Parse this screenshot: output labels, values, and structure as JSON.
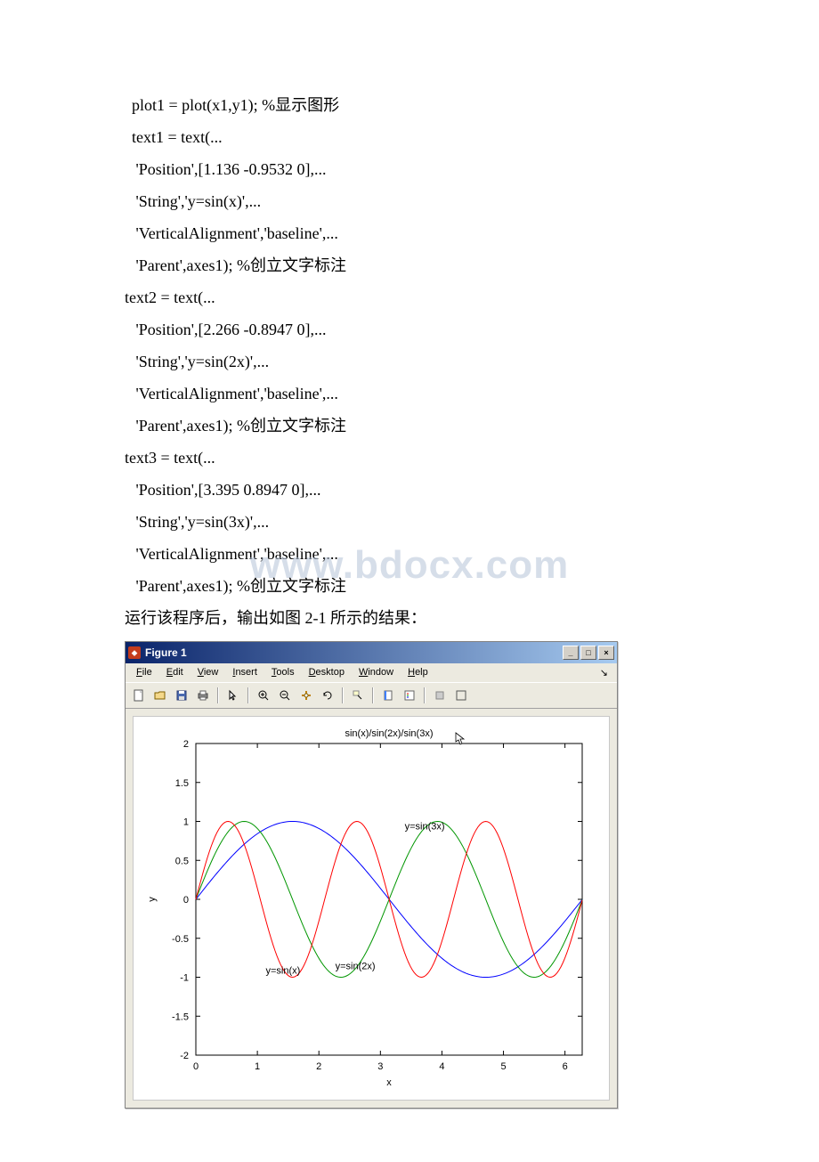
{
  "code": {
    "l1": "plot1 = plot(x1,y1); %显示图形",
    "l2": "text1 = text(...",
    "l3": " 'Position',[1.136 -0.9532 0],...",
    "l4": " 'String','y=sin(x)',...",
    "l5": " 'VerticalAlignment','baseline',...",
    "l6": " 'Parent',axes1); %创立文字标注",
    "l7": "text2 = text(...",
    "l8": " 'Position',[2.266 -0.8947 0],...",
    "l9": " 'String','y=sin(2x)',...",
    "l10": " 'VerticalAlignment','baseline',...",
    "l11": " 'Parent',axes1); %创立文字标注",
    "l12": "text3 = text(...",
    "l13": " 'Position',[3.395 0.8947 0],...",
    "l14": " 'String','y=sin(3x)',...",
    "l15": " 'VerticalAlignment','baseline',...",
    "l16": " 'Parent',axes1); %创立文字标注",
    "l17": "运行该程序后，输出如图 2-1 所示的结果："
  },
  "watermark": "www.bdocx.com",
  "window": {
    "title": "Figure 1",
    "min": "_",
    "max": "□",
    "close": "×",
    "menu": {
      "file": "File",
      "edit": "Edit",
      "view": "View",
      "insert": "Insert",
      "tools": "Tools",
      "desktop": "Desktop",
      "window": "Window",
      "help": "Help",
      "dock": "↘"
    },
    "icons": {
      "new": "new-icon",
      "open": "open-icon",
      "save": "save-icon",
      "print": "print-icon",
      "pointer": "pointer-icon",
      "zoomin": "zoom-in-icon",
      "zoomout": "zoom-out-icon",
      "pan": "pan-icon",
      "rotate": "rotate-icon",
      "datacursor": "data-cursor-icon",
      "colorbar": "colorbar-icon",
      "legend": "legend-icon",
      "hide": "hide-plot-icon",
      "show": "show-plot-icon"
    }
  },
  "chart_data": {
    "type": "line",
    "title": "sin(x)/sin(2x)/sin(3x)",
    "xlabel": "x",
    "ylabel": "y",
    "xlim": [
      0,
      6.28
    ],
    "ylim": [
      -2,
      2
    ],
    "xticks": [
      0,
      1,
      2,
      3,
      4,
      5,
      6
    ],
    "yticks": [
      -2,
      -1.5,
      -1,
      -0.5,
      0,
      0.5,
      1,
      1.5,
      2
    ],
    "series": [
      {
        "name": "y=sin(x)",
        "color": "#0000ff",
        "formula": "sin(x)"
      },
      {
        "name": "y=sin(2x)",
        "color": "#009600",
        "formula": "sin(2x)"
      },
      {
        "name": "y=sin(3x)",
        "color": "#ff0000",
        "formula": "sin(3x)"
      }
    ],
    "annotations": [
      {
        "text": "y=sin(x)",
        "x": 1.136,
        "y": -0.9532
      },
      {
        "text": "y=sin(2x)",
        "x": 2.266,
        "y": -0.8947
      },
      {
        "text": "y=sin(3x)",
        "x": 3.395,
        "y": 0.8947
      }
    ]
  }
}
